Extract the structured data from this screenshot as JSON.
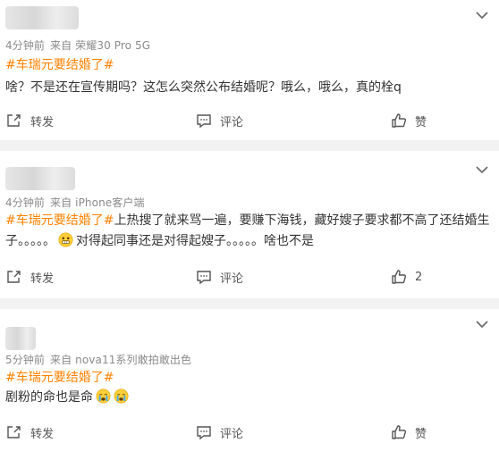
{
  "colors": {
    "topic": "#ff8200",
    "separator": "#f2f2f2",
    "meta": "#8a8a8a"
  },
  "posts": [
    {
      "time": "4分钟前",
      "source": "来自 荣耀30 Pro 5G",
      "topic": "#车瑞元要结婚了#",
      "text": "啥？不是还在宣传期吗？这怎么突然公布结婚呢？哦么，哦么，真的栓q",
      "repost_label": "转发",
      "comment_label": "评论",
      "like_label": "赞"
    },
    {
      "time": "4分钟前",
      "source": "来自 iPhone客户端",
      "topic": "#车瑞元要结婚了#",
      "text_line1_rest": "上热搜了就来骂一遍，要赚下海钱，藏好嫂子要求都不高了还结婚生",
      "text_line2_start": "子。。。。。",
      "text_line2_end": "对得起同事还是对得起嫂子。。。。。啥也不是",
      "emoji_icon": "grimace-emoji-icon",
      "repost_label": "转发",
      "comment_label": "评论",
      "like_count": "2"
    },
    {
      "time": "5分钟前",
      "source": "来自 nova11系列敢拍敢出色",
      "topic": "#车瑞元要结婚了#",
      "text": "剧粉的命也是命",
      "emoji_icon": "crying-emoji-icon",
      "repost_label": "转发",
      "comment_label": "评论",
      "like_label": "赞"
    }
  ]
}
